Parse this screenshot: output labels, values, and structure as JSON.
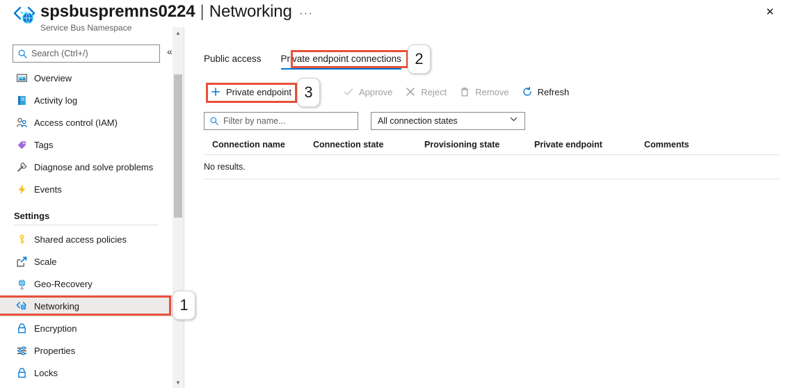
{
  "header": {
    "resource_name": "spsbuspremns0224",
    "separator": "|",
    "page_name": "Networking",
    "subtitle": "Service Bus Namespace",
    "ellipsis": "···",
    "close_label": "✕",
    "icon": "service-bus-networking-icon"
  },
  "sidebar": {
    "search": {
      "placeholder": "Search (Ctrl+/)",
      "icon": "search-icon"
    },
    "collapse": {
      "label": "«",
      "icon": "collapse-chevrons-icon"
    },
    "items": [
      {
        "label": "Overview",
        "icon": "overview-icon",
        "selected": false
      },
      {
        "label": "Activity log",
        "icon": "activity-log-icon",
        "selected": false
      },
      {
        "label": "Access control (IAM)",
        "icon": "access-control-icon",
        "selected": false
      },
      {
        "label": "Tags",
        "icon": "tags-icon",
        "selected": false
      },
      {
        "label": "Diagnose and solve problems",
        "icon": "diagnose-icon",
        "selected": false
      },
      {
        "label": "Events",
        "icon": "events-icon",
        "selected": false
      }
    ],
    "group_label": "Settings",
    "settings_items": [
      {
        "label": "Shared access policies",
        "icon": "key-icon",
        "selected": false
      },
      {
        "label": "Scale",
        "icon": "scale-icon",
        "selected": false
      },
      {
        "label": "Geo-Recovery",
        "icon": "geo-recovery-icon",
        "selected": false
      },
      {
        "label": "Networking",
        "icon": "networking-icon",
        "selected": true
      },
      {
        "label": "Encryption",
        "icon": "lock-icon",
        "selected": false
      },
      {
        "label": "Properties",
        "icon": "properties-icon",
        "selected": false
      },
      {
        "label": "Locks",
        "icon": "lock-icon",
        "selected": false
      }
    ]
  },
  "content": {
    "tabs": [
      {
        "label": "Public access",
        "active": false
      },
      {
        "label": "Private endpoint connections",
        "active": true
      }
    ],
    "commands": [
      {
        "label": "Private endpoint",
        "icon": "plus-icon",
        "disabled": false
      },
      {
        "label": "Approve",
        "icon": "checkmark-icon",
        "disabled": true
      },
      {
        "label": "Reject",
        "icon": "cross-icon",
        "disabled": true
      },
      {
        "label": "Remove",
        "icon": "trash-icon",
        "disabled": true
      },
      {
        "label": "Refresh",
        "icon": "refresh-icon",
        "disabled": false
      }
    ],
    "filter": {
      "placeholder": "Filter by name...",
      "icon": "search-icon",
      "value": ""
    },
    "state_filter": {
      "value": "All connection states",
      "icon": "chevron-down-icon"
    },
    "table": {
      "columns": [
        "Connection name",
        "Connection state",
        "Provisioning state",
        "Private endpoint",
        "Comments"
      ],
      "rows": [],
      "empty_message": "No results."
    }
  },
  "annotations": [
    {
      "number": "1",
      "target": "sidebar-item-networking"
    },
    {
      "number": "2",
      "target": "tab-private-endpoint-connections"
    },
    {
      "number": "3",
      "target": "private-endpoint-command"
    }
  ],
  "colors": {
    "accent": "#0078d4",
    "annotation_red": "#e8503a",
    "selected_bg": "#edebe9",
    "disabled_text": "#a19f9d"
  }
}
